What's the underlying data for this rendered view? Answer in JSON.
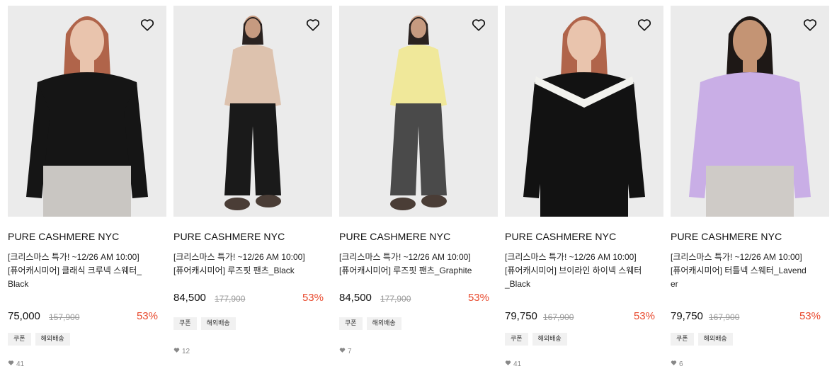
{
  "products": [
    {
      "brand": "PURE CASHMERE NYC",
      "title_line1": "[크리스마스 특가! ~12/26 AM 10:00]",
      "title_line2": "[퓨어캐시미어] 클래식 크루넥 스웨터_",
      "title_line3": "Black",
      "price": "75,000",
      "original_price": "157,900",
      "discount": "53%",
      "tags": [
        "쿠폰",
        "해외배송"
      ],
      "likes": "41",
      "top_color": "#151515",
      "bottom_color": "#c9c6c2",
      "skin": "#e9c4ad",
      "hair": "#b0644a"
    },
    {
      "brand": "PURE CASHMERE NYC",
      "title_line1": "[크리스마스 특가! ~12/26 AM 10:00]",
      "title_line2": "[퓨어캐시미어] 루즈핏 팬츠_Black",
      "title_line3": "",
      "price": "84,500",
      "original_price": "177,900",
      "discount": "53%",
      "tags": [
        "쿠폰",
        "해외배송"
      ],
      "likes": "12",
      "top_color": "#ddc2ae",
      "bottom_color": "#1a1a1a",
      "skin": "#c69a80",
      "hair": "#2a2220"
    },
    {
      "brand": "PURE CASHMERE NYC",
      "title_line1": "[크리스마스 특가! ~12/26 AM 10:00]",
      "title_line2": "[퓨어캐시미어] 루즈핏 팬츠_Graphite",
      "title_line3": "",
      "price": "84,500",
      "original_price": "177,900",
      "discount": "53%",
      "tags": [
        "쿠폰",
        "해외배송"
      ],
      "likes": "7",
      "top_color": "#f0e89a",
      "bottom_color": "#4a4a4a",
      "skin": "#c69a80",
      "hair": "#2a2220"
    },
    {
      "brand": "PURE CASHMERE NYC",
      "title_line1": "[크리스마스 특가! ~12/26 AM 10:00]",
      "title_line2": "[퓨어캐시미어] 브이라인 하이넥 스웨터",
      "title_line3": "_Black",
      "price": "79,750",
      "original_price": "167,900",
      "discount": "53%",
      "tags": [
        "쿠폰",
        "해외배송"
      ],
      "likes": "41",
      "top_color": "#121212",
      "bottom_color": "#121212",
      "skin": "#e9c4ad",
      "hair": "#b0644a"
    },
    {
      "brand": "PURE CASHMERE NYC",
      "title_line1": "[크리스마스 특가! ~12/26 AM 10:00]",
      "title_line2": "[퓨어캐시미어] 터틀넥 스웨터_Lavend",
      "title_line3": "er",
      "price": "79,750",
      "original_price": "167,900",
      "discount": "53%",
      "tags": [
        "쿠폰",
        "해외배송"
      ],
      "likes": "6",
      "top_color": "#c9aee6",
      "bottom_color": "#cfcbc7",
      "skin": "#c49474",
      "hair": "#1e1816"
    }
  ],
  "icons": {
    "wishlist": "heart-outline-icon",
    "likes": "heart-filled-icon"
  },
  "colors": {
    "discount": "#e8492d",
    "tag_bg": "#f1f1f1",
    "image_bg": "#ebebeb"
  }
}
